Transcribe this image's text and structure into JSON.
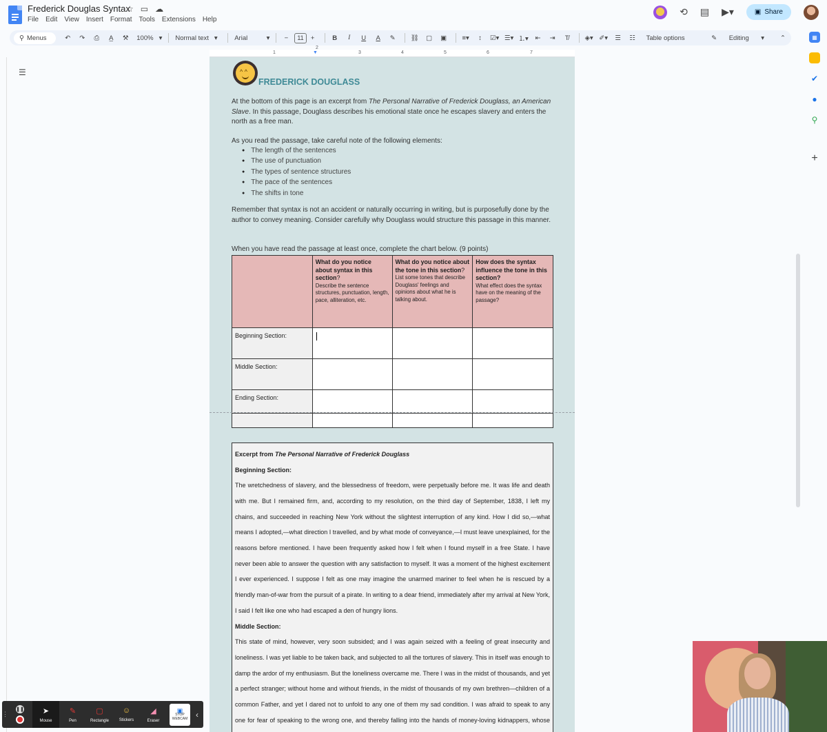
{
  "header": {
    "doc_title": "Frederick Douglas Syntax",
    "menu": [
      "File",
      "Edit",
      "View",
      "Insert",
      "Format",
      "Tools",
      "Extensions",
      "Help"
    ],
    "share_label": "Share"
  },
  "toolbar": {
    "menus_label": "Menus",
    "zoom": "100%",
    "style": "Normal text",
    "font": "Arial",
    "font_size": "11",
    "table_options": "Table options",
    "mode": "Editing"
  },
  "ruler": [
    "1",
    "2",
    "3",
    "4",
    "5",
    "6",
    "7"
  ],
  "doc": {
    "heading": "FREDERICK DOUGLASS",
    "intro_1": "At the bottom of this page is an excerpt from ",
    "intro_title": "The Personal Narrative of Frederick Douglass, an American Slave",
    "intro_2": ". In this passage, Douglass describes his emotional state once he escapes slavery and enters the north as a free man.",
    "read_prompt": "As you read the passage, take careful note of the following elements:",
    "elements": [
      "The length of the sentences",
      "The use of punctuation",
      "The types of sentence structures",
      "The pace of the sentences",
      "The shifts in tone"
    ],
    "remember": "Remember that syntax is not an accident or naturally occurring in writing, but is purposefully done by the author to convey meaning. Consider carefully why Douglass would structure this passage in this manner.",
    "chart_prompt": "When you have read the passage at least once, complete the chart below. (9 points)"
  },
  "table": {
    "headers": [
      {
        "bold": "What do you notice about syntax in this section",
        "mark": "?",
        "sub": "Describe the sentence structures, punctuation, length, pace, alliteration, etc."
      },
      {
        "bold": "What do you notice about the tone in this section",
        "mark": "?",
        "sub": "List some tones that describe Douglass' feelings and opinions about what he is talking about."
      },
      {
        "bold": "How does the syntax influence the tone in this section?",
        "mark": "",
        "sub": "What effect does the syntax have on the meaning of the passage?"
      }
    ],
    "rows": [
      "Beginning Section:",
      "Middle Section:",
      "Ending Section:",
      ""
    ]
  },
  "excerpt": {
    "heading_prefix": "Excerpt from ",
    "heading_title": "The Personal Narrative of Frederick Douglass",
    "beginning_label": "Beginning Section:",
    "beginning_text": "The wretchedness of slavery, and the blessedness of freedom, were perpetually before me. It was life and death with me. But I remained firm, and, according to my resolution, on the third day of September, 1838, I left my chains, and succeeded in reaching New York without the slightest interruption of any kind. How I did so,—what means I adopted,—what direction I travelled, and by what mode of conveyance,—I must leave unexplained, for the reasons before mentioned. I have been frequently asked how I felt when I found myself in a free State. I have never been able to answer the question with any satisfaction to myself. It was a moment of the highest excitement I ever experienced. I suppose I felt as one may imagine the unarmed mariner to feel when he is rescued by a friendly man-of-war from the pursuit of a pirate. In writing to a dear friend, immediately after my arrival at New York, I said I felt like one who had escaped a den of hungry lions.",
    "middle_label": "Middle Section:",
    "middle_text": "This state of mind, however, very soon subsided; and I was again seized with a feeling of great insecurity and loneliness. I was yet liable to be taken back, and subjected to all the tortures of slavery. This in itself was enough to damp the ardor of my enthusiasm. But the loneliness overcame me. There I was in the midst of thousands, and yet a perfect stranger; without home and without friends, in the midst of thousands of my own brethren—children of a common Father, and yet I dared not to unfold to any one of them my sad condition. I was afraid to speak to any one for fear of speaking to the wrong one, and thereby falling into the hands of money-loving kidnappers, whose business it was to lie in wait for the panting fugitive."
  },
  "recorder": {
    "tools": [
      "Mouse",
      "Pen",
      "Rectangle",
      "Stickers",
      "Eraser"
    ],
    "webcam_label": "STOP WEBCAM"
  }
}
